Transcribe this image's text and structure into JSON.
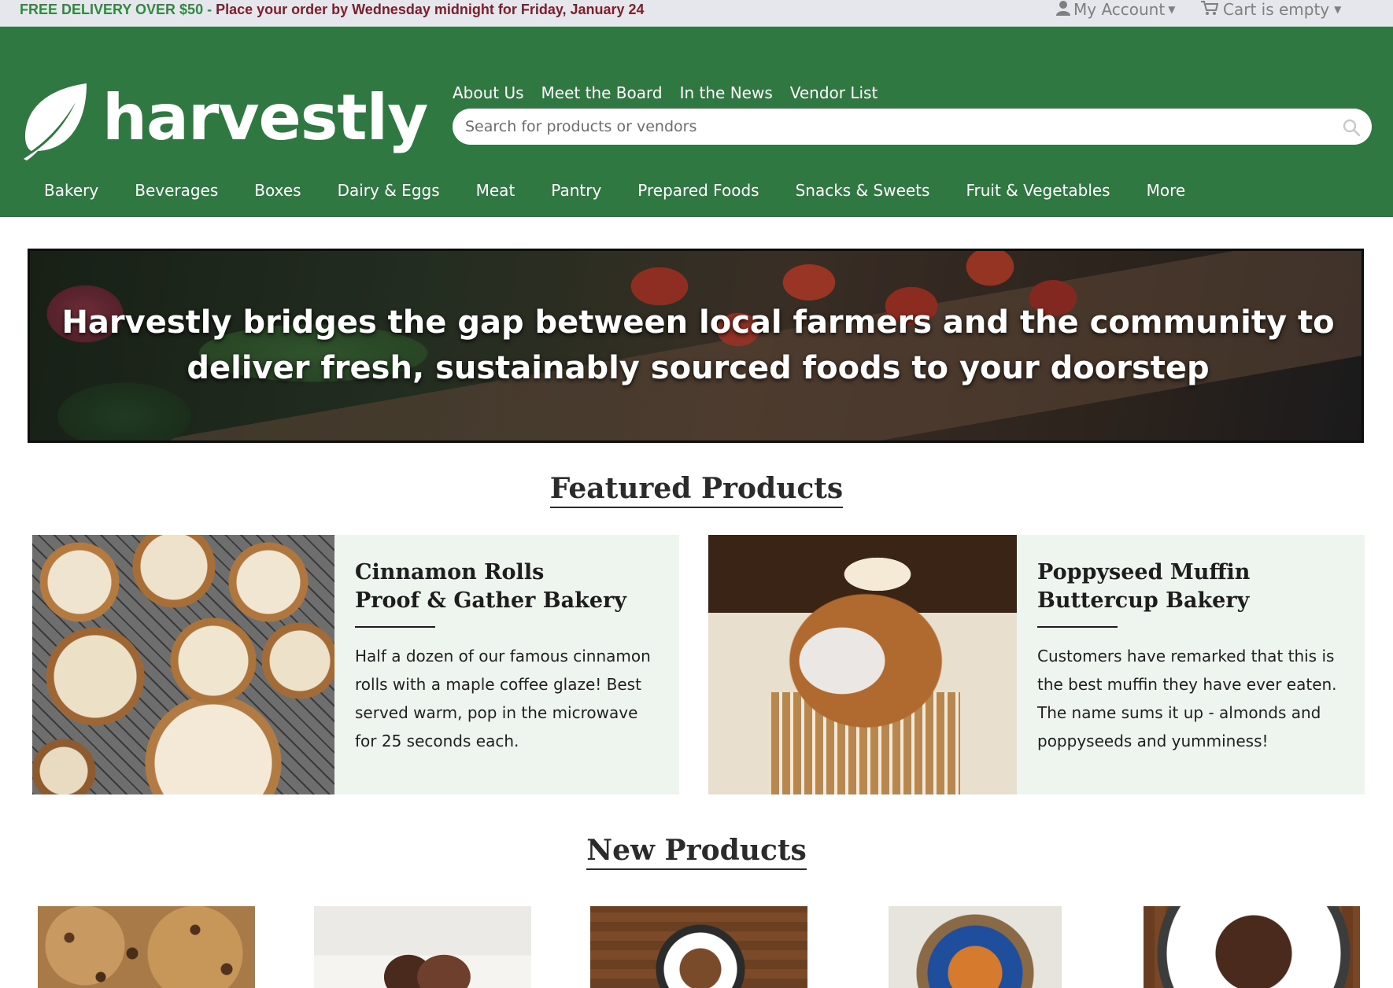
{
  "topbar": {
    "promo_highlight": "FREE DELIVERY OVER $50",
    "promo_sep": " - ",
    "promo_rest": "Place your order by Wednesday midnight for Friday, January 24",
    "account_label": "My Account",
    "cart_label": "Cart is empty"
  },
  "brand": {
    "name": "harvestly"
  },
  "topnav": {
    "items": [
      "About Us",
      "Meet the Board",
      "In the News",
      "Vendor List"
    ]
  },
  "search": {
    "placeholder": "Search for products or vendors"
  },
  "categories": [
    "Bakery",
    "Beverages",
    "Boxes",
    "Dairy & Eggs",
    "Meat",
    "Pantry",
    "Prepared Foods",
    "Snacks & Sweets",
    "Fruit & Vegetables",
    "More"
  ],
  "hero": {
    "line1": "Harvestly bridges the gap between local farmers and the community to",
    "line2": "deliver fresh, sustainably sourced foods to your doorstep"
  },
  "featured": {
    "title": "Featured Products",
    "products": [
      {
        "name": "Cinnamon Rolls",
        "vendor": "Proof & Gather Bakery",
        "description": "Half a dozen of our famous cinnamon rolls with a maple coffee glaze! Best served warm, pop in the microwave for 25 seconds each."
      },
      {
        "name": "Poppyseed Muffin",
        "vendor": "Buttercup Bakery",
        "description": "Customers have remarked that this is the best muffin they have ever eaten. The name sums it up - almonds and poppyseeds and yumminess!"
      }
    ]
  },
  "new_products": {
    "title": "New Products"
  },
  "colors": {
    "brand_green": "#307841",
    "promo_green": "#2f8a3e",
    "promo_red": "#7a1f2b",
    "card_bg": "#eef4ee"
  },
  "icons": [
    "user-icon",
    "cart-icon",
    "leaf-logo-icon",
    "search-icon"
  ]
}
